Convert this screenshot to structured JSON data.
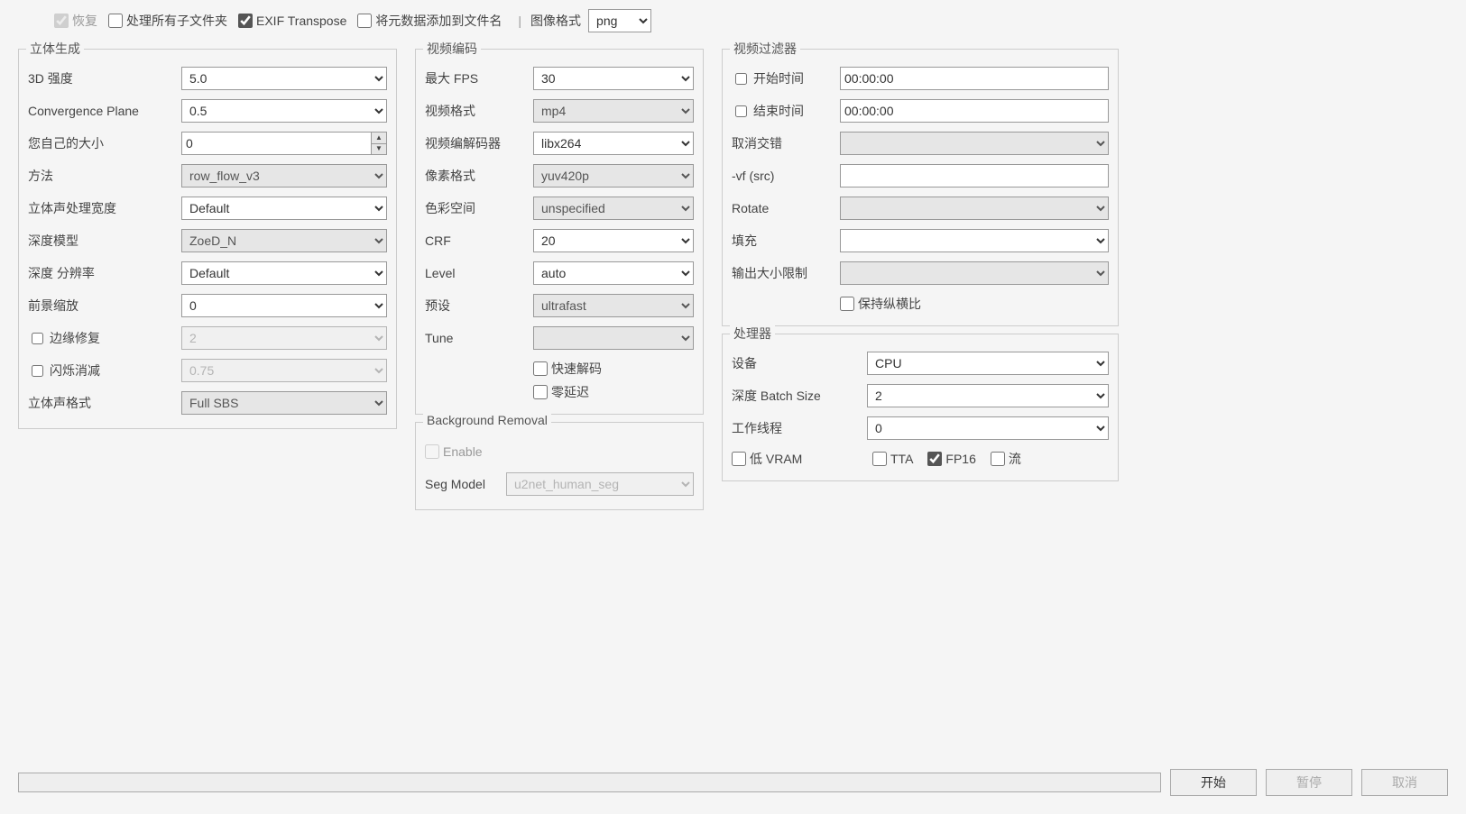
{
  "topbar": {
    "restore": "恢复",
    "process_sub": "处理所有子文件夹",
    "exif": "EXIF Transpose",
    "append_meta": "将元数据添加到文件名",
    "image_format_label": "图像格式",
    "image_format": "png"
  },
  "stereo": {
    "title": "立体生成",
    "intensity_label": "3D 强度",
    "intensity": "5.0",
    "convergence_label": "Convergence Plane",
    "convergence": "0.5",
    "own_size_label": "您自己的大小",
    "own_size": "0",
    "method_label": "方法",
    "method": "row_flow_v3",
    "stereo_width_label": "立体声处理宽度",
    "stereo_width": "Default",
    "depth_model_label": "深度模型",
    "depth_model": "ZoeD_N",
    "depth_res_label": "深度 分辨率",
    "depth_res": "Default",
    "fg_scale_label": "前景缩放",
    "fg_scale": "0",
    "edge_fix_label": "边缘修复",
    "edge_fix": "2",
    "flicker_label": "闪烁消减",
    "flicker": "0.75",
    "stereo_format_label": "立体声格式",
    "stereo_format": "Full SBS"
  },
  "encoding": {
    "title": "视频编码",
    "max_fps_label": "最大 FPS",
    "max_fps": "30",
    "video_format_label": "视频格式",
    "video_format": "mp4",
    "codec_label": "视频编解码器",
    "codec": "libx264",
    "pixfmt_label": "像素格式",
    "pixfmt": "yuv420p",
    "colorspace_label": "色彩空间",
    "colorspace": "unspecified",
    "crf_label": "CRF",
    "crf": "20",
    "level_label": "Level",
    "level": "auto",
    "preset_label": "预设",
    "preset": "ultrafast",
    "tune_label": "Tune",
    "tune": "",
    "fast_decode": "快速解码",
    "zero_latency": "零延迟"
  },
  "bgremoval": {
    "title": "Background Removal",
    "enable": "Enable",
    "seg_label": "Seg Model",
    "seg_model": "u2net_human_seg"
  },
  "filter": {
    "title": "视频过滤器",
    "start_label": "开始时间",
    "start": "00:00:00",
    "end_label": "结束时间",
    "end": "00:00:00",
    "deinterlace_label": "取消交错",
    "deinterlace": "",
    "vf_label": "-vf (src)",
    "vf": "",
    "rotate_label": "Rotate",
    "rotate": "",
    "pad_label": "填充",
    "pad": "",
    "outsize_label": "输出大小限制",
    "outsize": "",
    "keep_aspect": "保持纵横比"
  },
  "processor": {
    "title": "处理器",
    "device_label": "设备",
    "device": "CPU",
    "batch_label": "深度 Batch Size",
    "batch": "2",
    "workers_label": "工作线程",
    "workers": "0",
    "low_vram": "低 VRAM",
    "tta": "TTA",
    "fp16": "FP16",
    "stream": "流"
  },
  "buttons": {
    "start": "开始",
    "pause": "暂停",
    "cancel": "取消"
  }
}
